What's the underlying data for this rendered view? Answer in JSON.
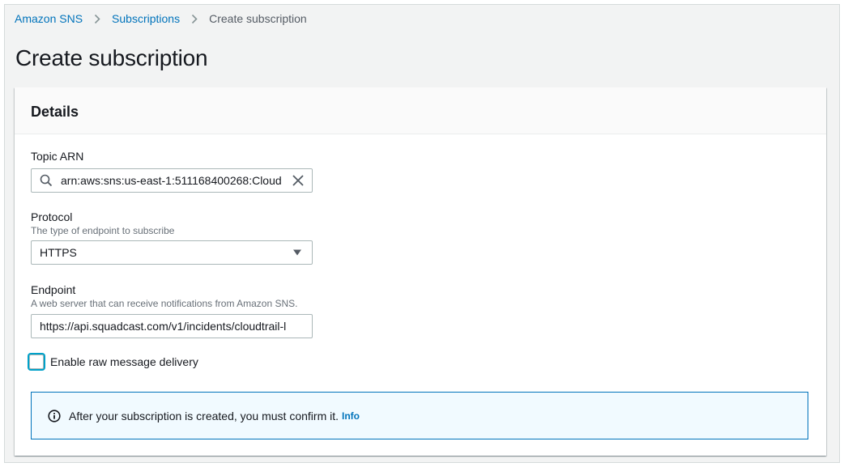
{
  "breadcrumb": {
    "items": [
      "Amazon SNS",
      "Subscriptions"
    ],
    "current": "Create subscription"
  },
  "page": {
    "title": "Create subscription"
  },
  "details": {
    "heading": "Details",
    "topic_arn": {
      "label": "Topic ARN",
      "value": "arn:aws:sns:us-east-1:511168400268:Cloud"
    },
    "protocol": {
      "label": "Protocol",
      "description": "The type of endpoint to subscribe",
      "selected": "HTTPS"
    },
    "endpoint": {
      "label": "Endpoint",
      "description": "A web server that can receive notifications from Amazon SNS.",
      "value": "https://api.squadcast.com/v1/incidents/cloudtrail-l"
    },
    "raw_delivery": {
      "label": "Enable raw message delivery",
      "checked": false
    },
    "alert": {
      "text": "After your subscription is created, you must confirm it.",
      "link": "Info"
    }
  },
  "colors": {
    "link": "#0073bb",
    "focus": "#00a1c9",
    "info_bg": "#f1faff"
  },
  "icons": [
    "chevron-right-icon",
    "search-icon",
    "close-icon",
    "caret-down-icon",
    "info-icon"
  ]
}
